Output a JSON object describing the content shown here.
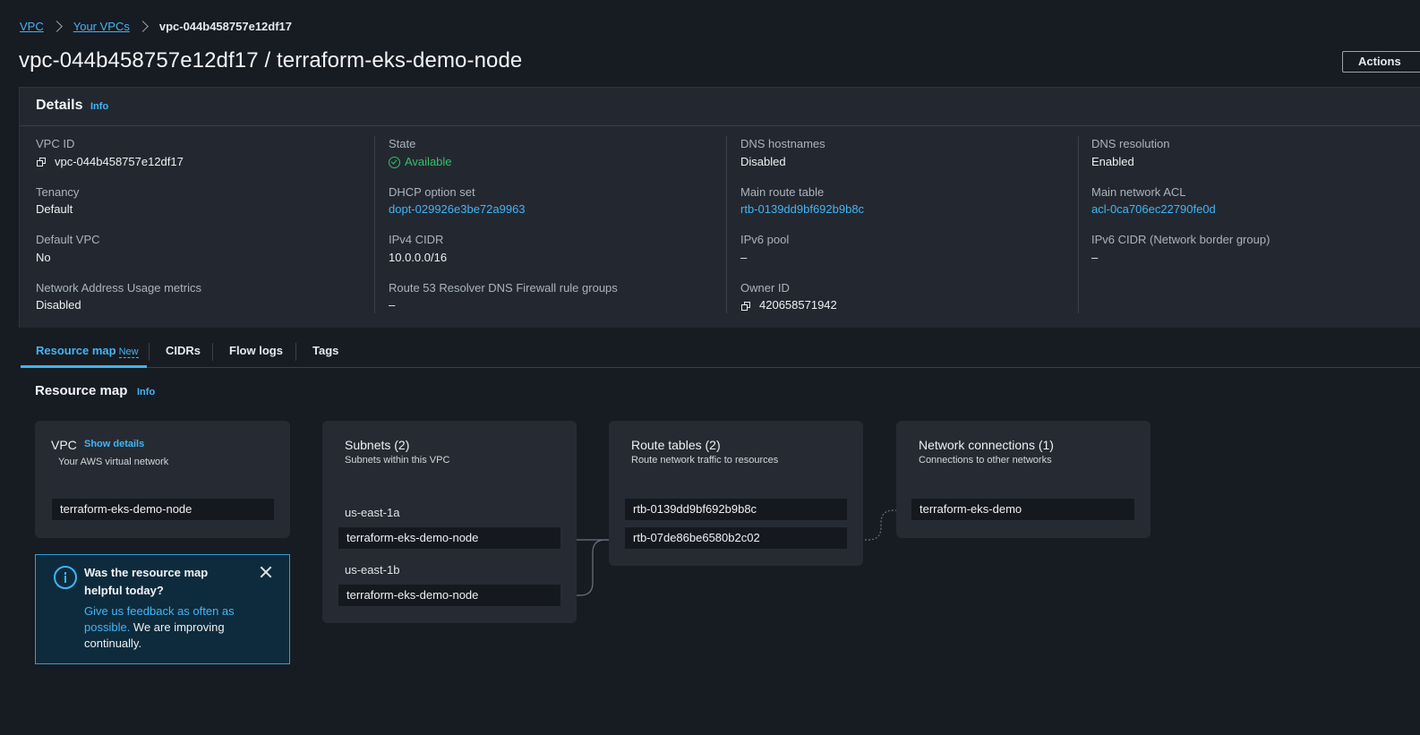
{
  "breadcrumb": {
    "items": [
      "VPC",
      "Your VPCs"
    ],
    "current": "vpc-044b458757e12df17"
  },
  "page": {
    "title": "vpc-044b458757e12df17 / terraform-eks-demo-node",
    "actions_label": "Actions"
  },
  "details": {
    "title": "Details",
    "info_label": "Info",
    "fields": {
      "vpc_id": {
        "label": "VPC ID",
        "value": "vpc-044b458757e12df17"
      },
      "state": {
        "label": "State",
        "value": "Available"
      },
      "dns_hostnames": {
        "label": "DNS hostnames",
        "value": "Disabled"
      },
      "dns_resolution": {
        "label": "DNS resolution",
        "value": "Enabled"
      },
      "tenancy": {
        "label": "Tenancy",
        "value": "Default"
      },
      "dhcp_option_set": {
        "label": "DHCP option set",
        "value": "dopt-029926e3be72a9963"
      },
      "main_route_table": {
        "label": "Main route table",
        "value": "rtb-0139dd9bf692b9b8c"
      },
      "main_network_acl": {
        "label": "Main network ACL",
        "value": "acl-0ca706ec22790fe0d"
      },
      "default_vpc": {
        "label": "Default VPC",
        "value": "No"
      },
      "ipv4_cidr": {
        "label": "IPv4 CIDR",
        "value": "10.0.0.0/16"
      },
      "ipv6_pool": {
        "label": "IPv6 pool",
        "value": "–"
      },
      "ipv6_cidr": {
        "label": "IPv6 CIDR (Network border group)",
        "value": "–"
      },
      "nau_metrics": {
        "label": "Network Address Usage metrics",
        "value": "Disabled"
      },
      "route53_firewall": {
        "label": "Route 53 Resolver DNS Firewall rule groups",
        "value": "–"
      },
      "owner_id": {
        "label": "Owner ID",
        "value": "420658571942"
      }
    }
  },
  "tabs": [
    {
      "label": "Resource map",
      "badge": "New",
      "active": true
    },
    {
      "label": "CIDRs"
    },
    {
      "label": "Flow logs"
    },
    {
      "label": "Tags"
    }
  ],
  "resource_map": {
    "title": "Resource map",
    "info_label": "Info",
    "vpc_card": {
      "title": "VPC",
      "show_details": "Show details",
      "subtitle": "Your AWS virtual network",
      "item": "terraform-eks-demo-node"
    },
    "subnets_card": {
      "title": "Subnets (2)",
      "subtitle": "Subnets within this VPC",
      "groups": [
        {
          "az": "us-east-1a",
          "item": "terraform-eks-demo-node"
        },
        {
          "az": "us-east-1b",
          "item": "terraform-eks-demo-node"
        }
      ]
    },
    "route_tables_card": {
      "title": "Route tables (2)",
      "subtitle": "Route network traffic to resources",
      "items": [
        "rtb-0139dd9bf692b9b8c",
        "rtb-07de86be6580b2c02"
      ]
    },
    "network_connections_card": {
      "title": "Network connections (1)",
      "subtitle": "Connections to other networks",
      "items": [
        "terraform-eks-demo"
      ]
    }
  },
  "feedback": {
    "title": "Was the resource map helpful today?",
    "link_text": "Give us feedback as often as possible.",
    "body_text": " We are improving continually."
  },
  "colors": {
    "background": "#171b22",
    "panel": "#232830",
    "accent_link": "#42b4f5",
    "status_ok": "#33c06a",
    "chip": "#15191f"
  }
}
